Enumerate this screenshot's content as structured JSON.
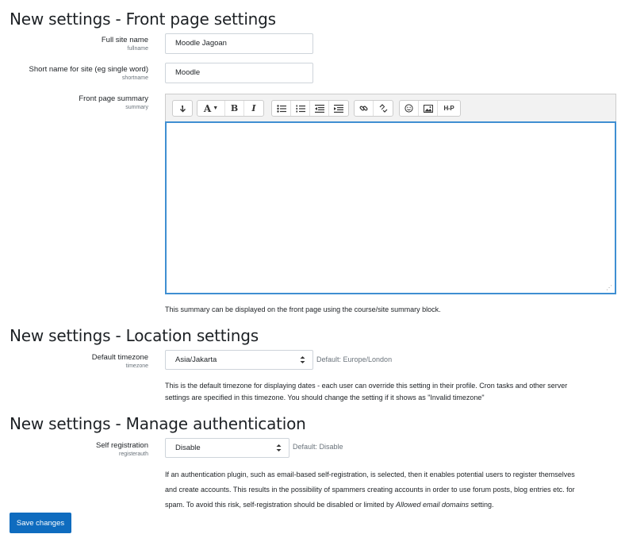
{
  "sections": {
    "front": {
      "title": "New settings - Front page settings"
    },
    "location": {
      "title": "New settings - Location settings"
    },
    "auth": {
      "title": "New settings - Manage authentication"
    }
  },
  "fullname": {
    "label": "Full site name",
    "key": "fullname",
    "value": "Moodle Jagoan"
  },
  "shortname": {
    "label": "Short name for site (eg single word)",
    "key": "shortname",
    "value": "Moodle"
  },
  "summary": {
    "label": "Front page summary",
    "key": "summary",
    "description": "This summary can be displayed on the front page using the course/site summary block.",
    "toolbar": [
      "collapse-icon",
      "font-style-icon",
      "bold-icon",
      "italic-icon",
      "unordered-list-icon",
      "ordered-list-icon",
      "outdent-icon",
      "indent-icon",
      "link-icon",
      "unlink-icon",
      "emoticon-icon",
      "image-icon",
      "h5p-icon"
    ],
    "bold_glyph": "B",
    "italic_glyph": "I",
    "font_glyph": "A",
    "h5p_glyph": "H-P"
  },
  "timezone": {
    "label": "Default timezone",
    "key": "timezone",
    "value": "Asia/Jakarta",
    "default": "Default: Europe/London",
    "description_1": "This is the default timezone for displaying dates - each user can override this setting in their profile. Cron tasks and other server",
    "description_2": "settings are specified in this timezone. You should change the setting if it shows as \"Invalid timezone\""
  },
  "registerauth": {
    "label": "Self registration",
    "key": "registerauth",
    "value": "Disable",
    "default": "Default: Disable",
    "description_1": "If an authentication plugin, such as email-based self-registration, is selected, then it enables potential users to register themselves",
    "description_2": "and create accounts. This results in the possibility of spammers creating accounts in order to use forum posts, blog entries etc. for",
    "description_3a": "spam. To avoid this risk, self-registration should be disabled or limited by ",
    "description_3em": "Allowed email domains",
    "description_3b": " setting."
  },
  "save_label": "Save changes",
  "colors": {
    "primary": "#0f6cbf",
    "focus": "#3f8fd2"
  }
}
